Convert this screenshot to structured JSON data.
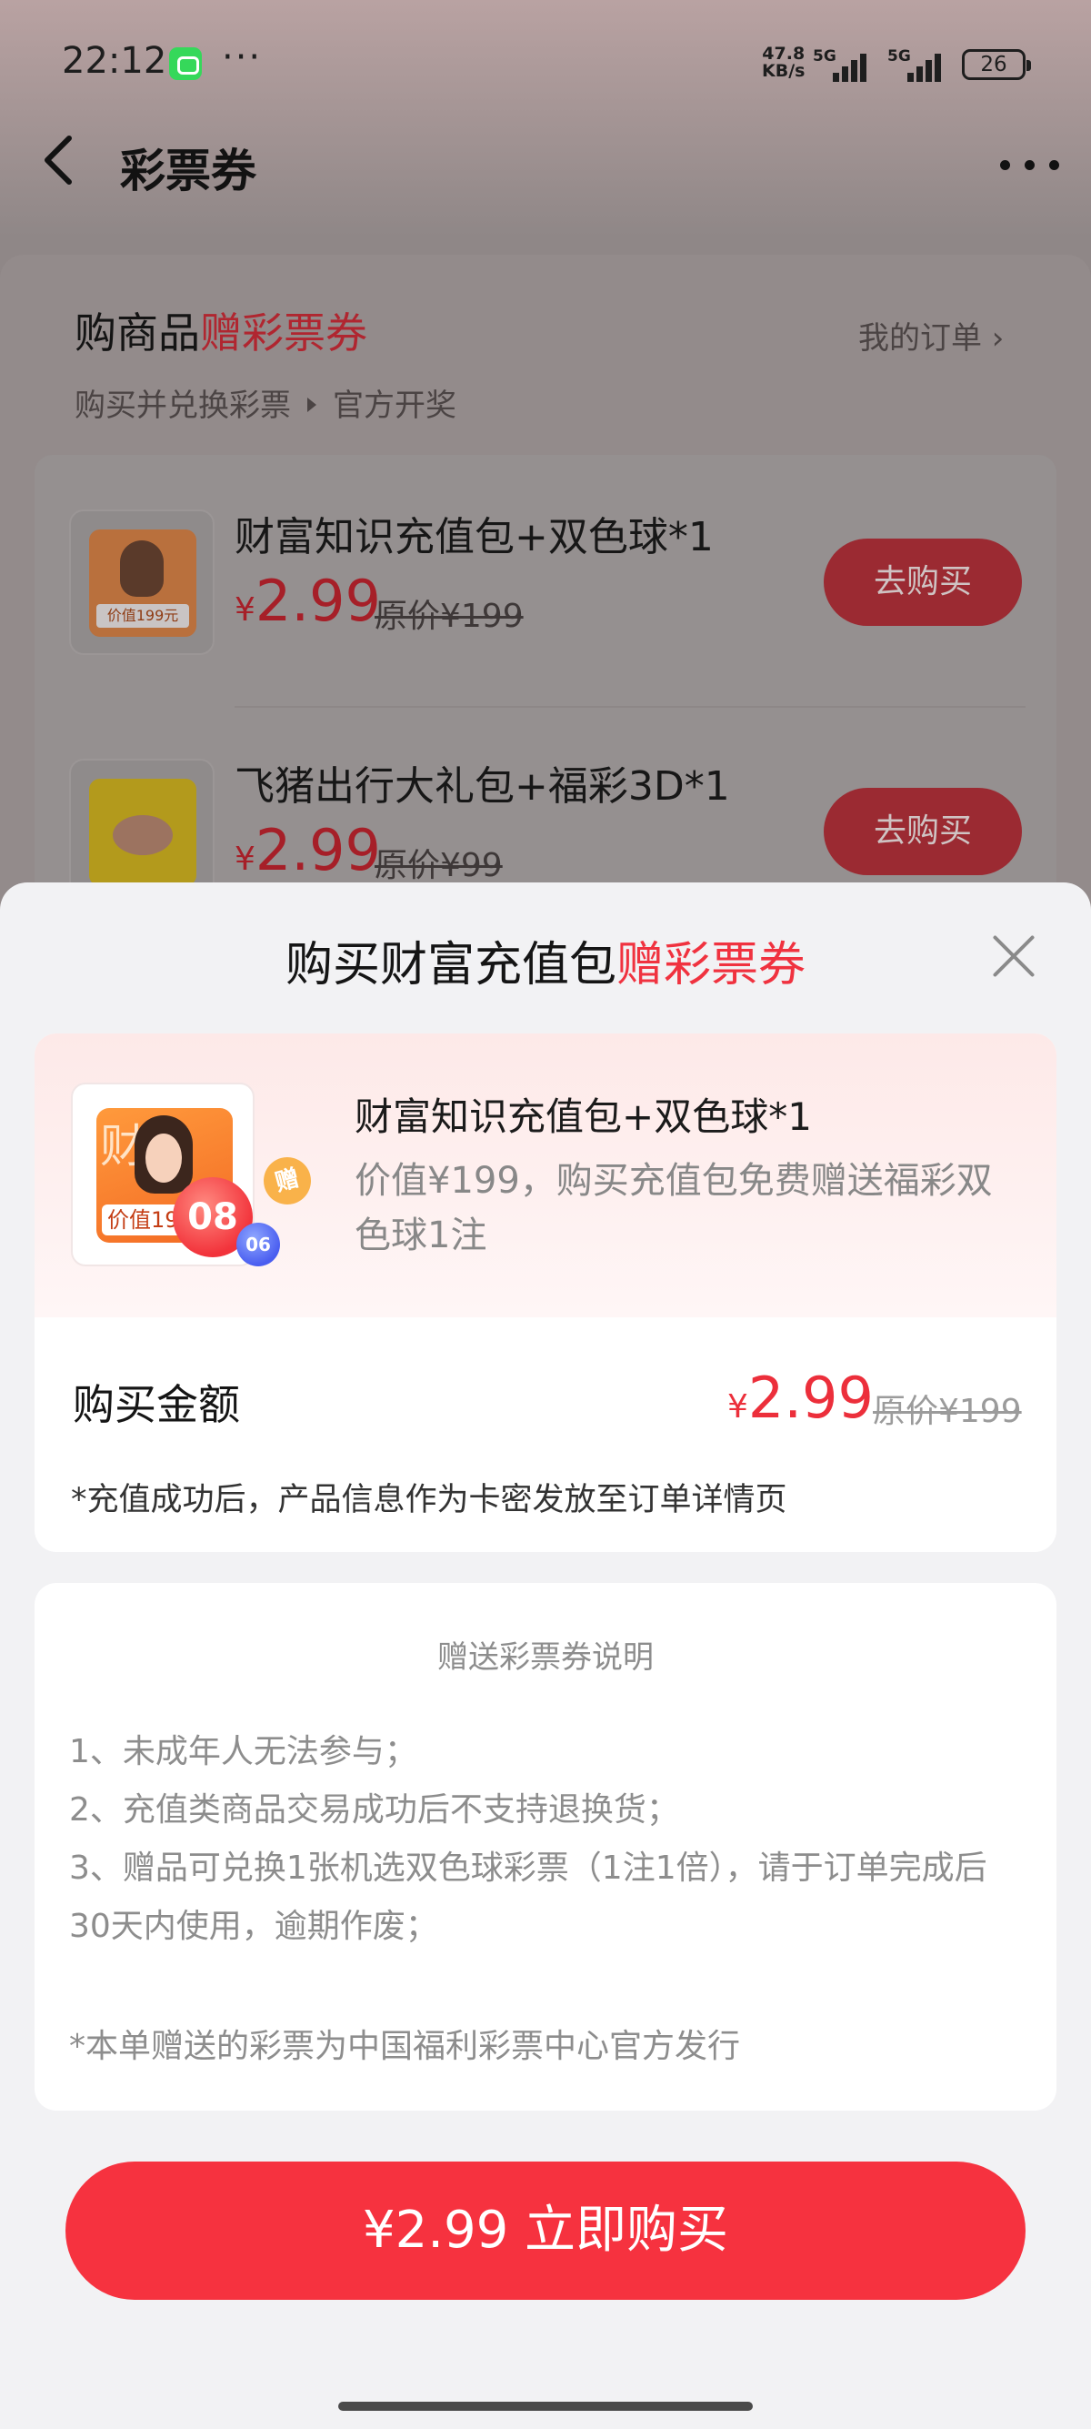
{
  "status_bar": {
    "time": "22:12",
    "dots": "···",
    "speed_value": "47.8",
    "speed_unit": "KB/s",
    "signal1_label": "5G",
    "signal2_label": "5G",
    "battery": "26"
  },
  "nav": {
    "title": "彩票券"
  },
  "promo": {
    "title_prefix": "购商品",
    "title_highlight": "赠彩票券",
    "orders_link": "我的订单 ›",
    "sub_step1": "购买并兑换彩票",
    "sub_step2": "官方开奖",
    "products": [
      {
        "name": "财富知识充值包+双色球*1",
        "currency": "¥",
        "price": "2.99",
        "original": "原价¥199",
        "button": "去购买",
        "thumb_text": "价值199元"
      },
      {
        "name": "飞猪出行大礼包+福彩3D*1",
        "currency": "¥",
        "price": "2.99",
        "original": "原价¥99",
        "button": "去购买"
      }
    ]
  },
  "sheet": {
    "title_prefix": "购买财富充值包",
    "title_highlight": "赠彩票券",
    "product": {
      "thumb_big_text": "财富",
      "thumb_tag": "价值199元",
      "ball_red": "08",
      "ball_blue": "06",
      "gift_badge": "赠",
      "name": "财富知识充值包+双色球*1",
      "description": "价值¥199，购买充值包免费赠送福彩双色球1注"
    },
    "amount": {
      "label": "购买金额",
      "currency": "¥",
      "price": "2.99",
      "original": "原价¥199",
      "note": "*充值成功后，产品信息作为卡密发放至订单详情页"
    },
    "info": {
      "title": "赠送彩票券说明",
      "lines": [
        "1、未成年人无法参与；",
        "2、充值类商品交易成功后不支持退换货；",
        "3、赠品可兑换1张机选双色球彩票（1注1倍），请于订单完成后30天内使用，逾期作废；"
      ],
      "footnote": "*本单赠送的彩票为中国福利彩票中心官方发行"
    },
    "cta_label": "¥2.99 立即购买"
  },
  "colors": {
    "accent_red": "#f6323f",
    "overlay_gray": "#8d8686",
    "sheet_bg": "#f2f2f4"
  }
}
